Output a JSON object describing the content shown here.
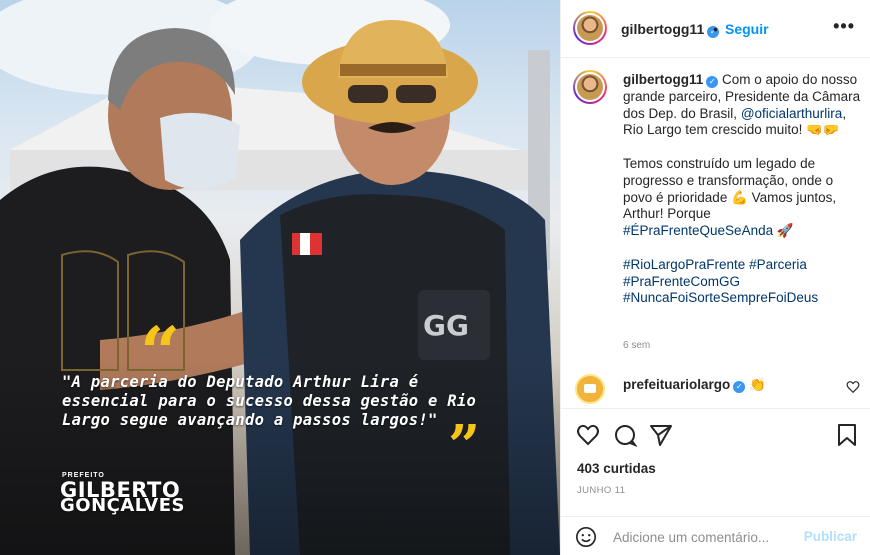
{
  "post": {
    "image": {
      "quote_open": "“",
      "quote_close": "”",
      "quote": "\"A parceria do Deputado Arthur Lira é essencial para o sucesso dessa gestão e Rio Largo segue avançando a passos largos!\"",
      "label_small": "PREFEITO",
      "name_line1": "GILBERTO",
      "name_line2": "GONÇALVES",
      "vest_badge": "GG"
    },
    "header": {
      "username": "gilbertogg11",
      "verified_icon": "verified-badge-icon",
      "separator": "•",
      "follow_label": "Seguir",
      "more_label": "•••"
    },
    "caption": {
      "username": "gilbertogg11",
      "p1_a": " Com o apoio do nosso grande parceiro, Presidente da Câmara dos Dep. do Brasil, ",
      "p1_mention": "@oficialarthurlira",
      "p1_b": ", Rio Largo tem crescido muito! 🤜🤛",
      "p2_a": "Temos construído um legado de progresso e transformação, onde o povo é prioridade 💪 Vamos juntos, Arthur! Porque ",
      "p2_tag": "#ÉPraFrenteQueSeAnda",
      "p2_b": " 🚀",
      "tag1": "#RioLargoPraFrente",
      "tag2": "#Parceria",
      "tag3": "#PraFrenteComGG",
      "tag4": "#NuncaFoiSorteSempreFoiDeus",
      "time_ago": "6 sem"
    },
    "comment": {
      "username": "prefeituariolargo",
      "text": "👏"
    },
    "likes": "403 curtidas",
    "date": "JUNHO 11",
    "comment_box": {
      "placeholder": "Adicione um comentário...",
      "publish_label": "Publicar"
    },
    "colors": {
      "link": "#0095f6",
      "hashtag": "#00376b",
      "muted": "#8e8e8e",
      "quote_yellow": "#f5c518"
    }
  }
}
